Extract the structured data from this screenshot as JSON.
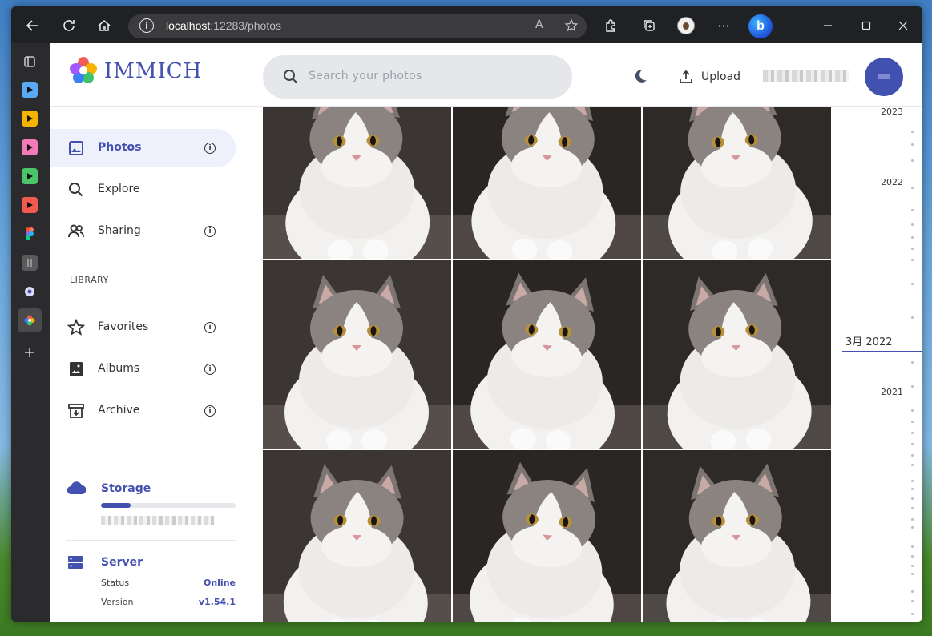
{
  "browser": {
    "url_host": "localhost",
    "url_path": ":12283/photos",
    "read_aloud_icon": "A",
    "menu_label": "···",
    "bing_label": "b"
  },
  "app": {
    "logo_text": "IMMICH",
    "search_placeholder": "Search your photos",
    "upload_label": "Upload",
    "accent_color": "#4250af"
  },
  "sidebar": {
    "items": [
      {
        "label": "Photos",
        "icon": "photos-icon",
        "active": true
      },
      {
        "label": "Explore",
        "icon": "explore-icon"
      },
      {
        "label": "Sharing",
        "icon": "sharing-icon"
      }
    ],
    "library_label": "LIBRARY",
    "library_items": [
      {
        "label": "Favorites",
        "icon": "star-icon"
      },
      {
        "label": "Albums",
        "icon": "albums-icon"
      },
      {
        "label": "Archive",
        "icon": "archive-icon"
      }
    ],
    "info_glyph": "i",
    "storage": {
      "title": "Storage",
      "used_fraction": 0.22
    },
    "server": {
      "title": "Server",
      "status_label": "Status",
      "status_value": "Online",
      "version_label": "Version",
      "version_value": "v1.54.1"
    }
  },
  "timeline": {
    "years": [
      "2023",
      "2022",
      "2021"
    ],
    "cursor": "3月 2022"
  }
}
